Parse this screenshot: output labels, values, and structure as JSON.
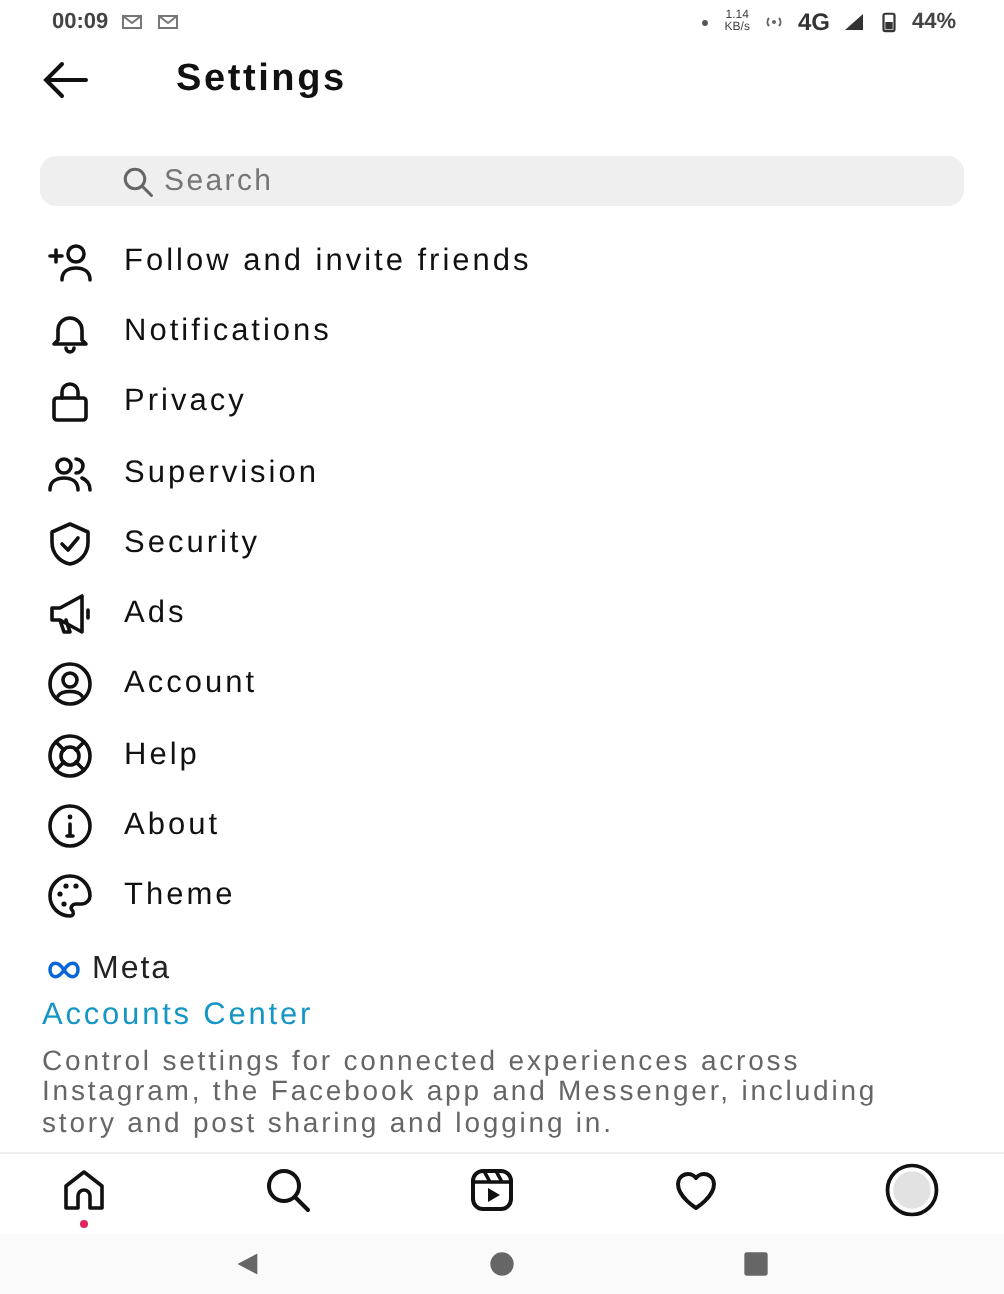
{
  "status_bar": {
    "time": "00:09",
    "speed": "1.14",
    "speed_unit": "KB/s",
    "network": "4G",
    "battery": "44%"
  },
  "header": {
    "title": "Settings"
  },
  "search": {
    "placeholder": "Search"
  },
  "items": [
    {
      "kind": "follow",
      "label": "Follow and invite friends"
    },
    {
      "kind": "bell",
      "label": "Notifications"
    },
    {
      "kind": "lock",
      "label": "Privacy"
    },
    {
      "kind": "people",
      "label": "Supervision"
    },
    {
      "kind": "shield",
      "label": "Security"
    },
    {
      "kind": "megaphone",
      "label": "Ads"
    },
    {
      "kind": "account",
      "label": "Account"
    },
    {
      "kind": "help",
      "label": "Help"
    },
    {
      "kind": "info",
      "label": "About"
    },
    {
      "kind": "palette",
      "label": "Theme"
    }
  ],
  "meta": {
    "brand": "Meta",
    "link": "Accounts Center",
    "description": "Control settings for connected experiences across Instagram, the Facebook app and Messenger, including story and post sharing and logging in."
  },
  "bottom_nav": [
    {
      "kind": "home",
      "badge": true
    },
    {
      "kind": "search",
      "badge": false
    },
    {
      "kind": "reels",
      "badge": false
    },
    {
      "kind": "heart",
      "badge": false
    },
    {
      "kind": "profile",
      "badge": false
    }
  ],
  "system_nav": [
    {
      "kind": "back"
    },
    {
      "kind": "home"
    },
    {
      "kind": "recents"
    }
  ]
}
